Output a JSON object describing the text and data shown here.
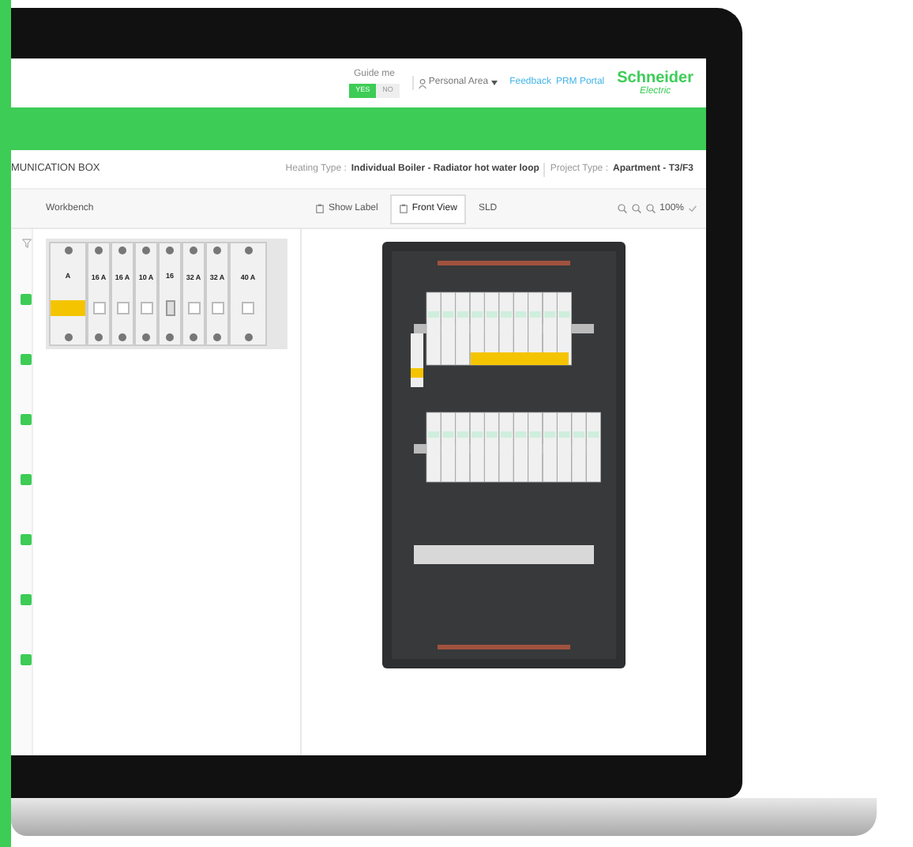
{
  "header": {
    "guide_label": "Guide me",
    "toggle": [
      {
        "label": "YES",
        "selected": true
      },
      {
        "label": "NO",
        "selected": false
      }
    ],
    "personal_area": "Personal Area",
    "links": [
      "Feedback",
      "PRM Portal"
    ],
    "logo": {
      "name": "Schneider",
      "sub": "Electric"
    }
  },
  "project": {
    "title": "MUNICATION BOX",
    "heating_label": "Heating Type :",
    "heating_value": "Individual Boiler - Radiator hot water loop",
    "project_label": "Project Type :",
    "project_value": "Apartment - T3/F3"
  },
  "workbench": {
    "title": "Workbench",
    "modules": [
      {
        "kind": "rcd",
        "rating": "A"
      },
      {
        "kind": "mcb",
        "rating": "16 A"
      },
      {
        "kind": "mcb",
        "rating": "16 A"
      },
      {
        "kind": "mcb",
        "rating": "10 A"
      },
      {
        "kind": "contactor",
        "rating": "16"
      },
      {
        "kind": "mcb",
        "rating": "32 A"
      },
      {
        "kind": "mcb",
        "rating": "32 A"
      },
      {
        "kind": "wide",
        "rating": "40 A"
      }
    ]
  },
  "view_tabs": [
    {
      "label": "Show Label",
      "selected": false
    },
    {
      "label": "Front View",
      "selected": true
    },
    {
      "label": "SLD",
      "selected": false
    }
  ],
  "zoom_level": "100%"
}
